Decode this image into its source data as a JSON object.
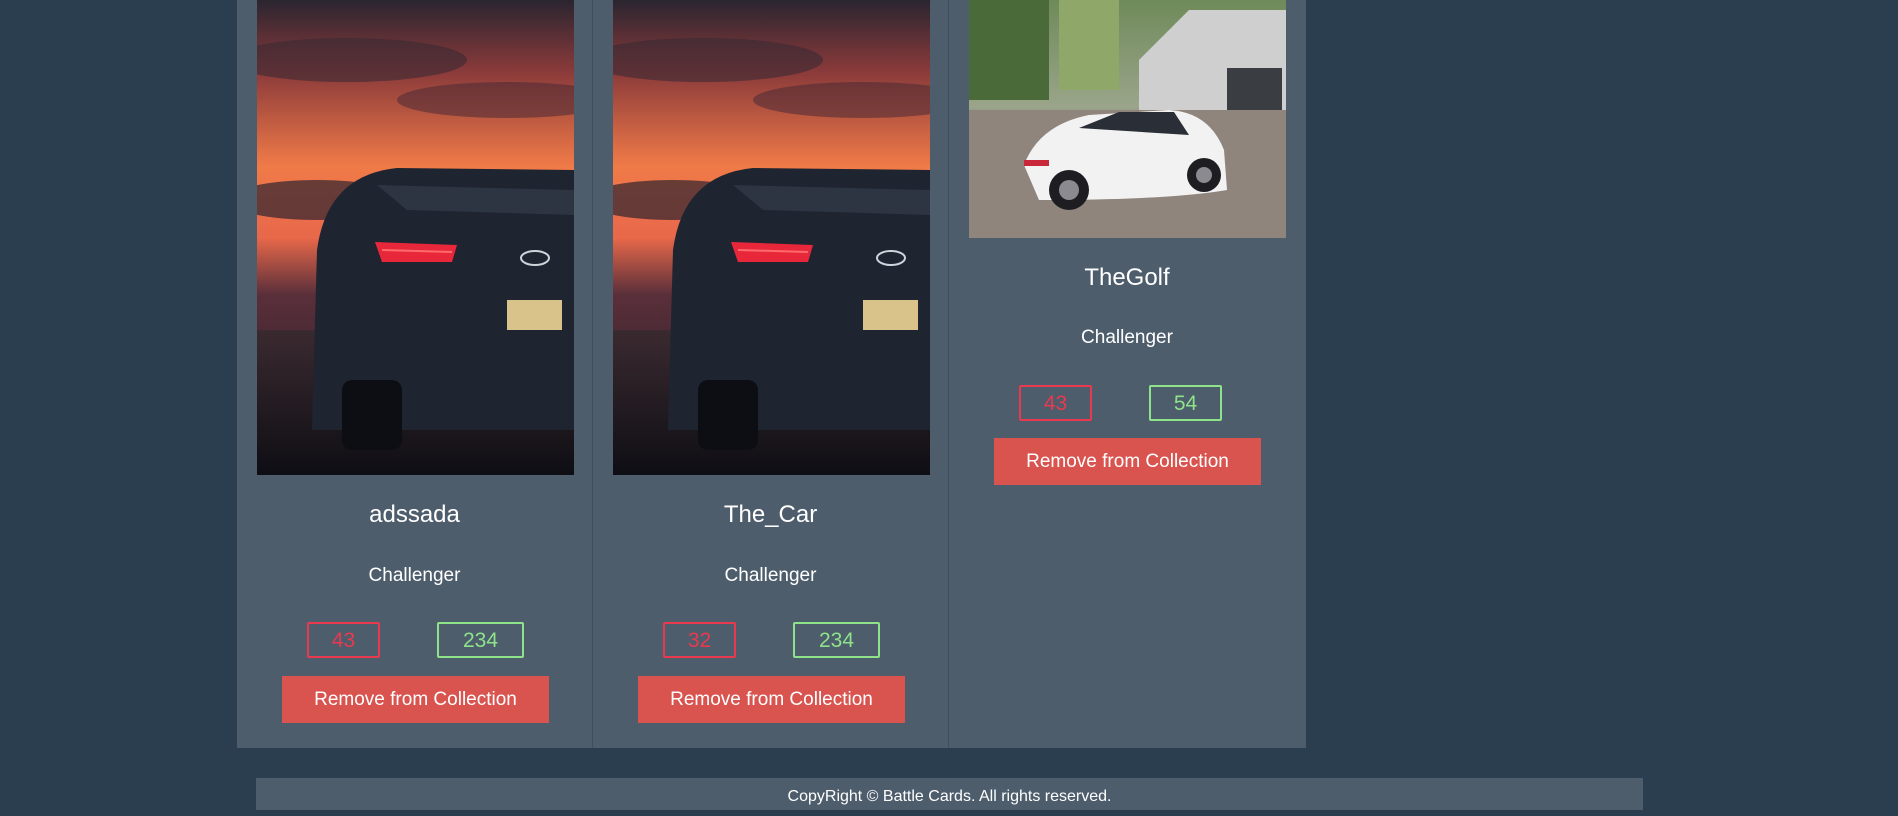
{
  "cards": [
    {
      "name": "adssada",
      "tier": "Challenger",
      "attack": "43",
      "defense": "234",
      "button_label": "Remove from Collection",
      "image": "car-photo-sunset-suv"
    },
    {
      "name": "The_Car",
      "tier": "Challenger",
      "attack": "32",
      "defense": "234",
      "button_label": "Remove from Collection",
      "image": "car-photo-sunset-suv"
    },
    {
      "name": "TheGolf",
      "tier": "Challenger",
      "attack": "43",
      "defense": "54",
      "button_label": "Remove from Collection",
      "image": "car-photo-white-hatchback"
    }
  ],
  "footer": {
    "text": "CopyRight © Battle Cards. All rights reserved."
  },
  "colors": {
    "page_bg": "#2b3e50",
    "card_bg": "#4e5d6c",
    "attack": "#e8394f",
    "defense": "#8ee38a",
    "button": "#d9534f"
  }
}
